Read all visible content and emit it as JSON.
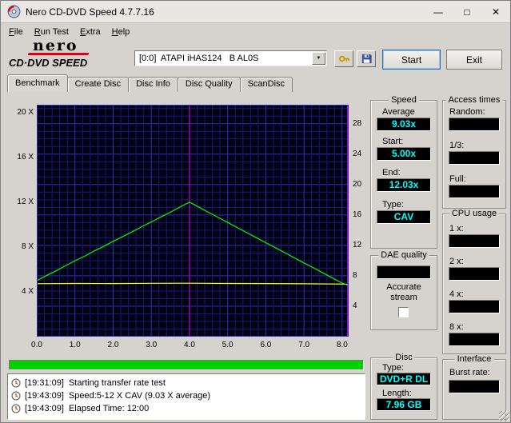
{
  "window": {
    "title": "Nero CD-DVD Speed 4.7.7.16",
    "controls": {
      "minimize": "—",
      "maximize": "□",
      "close": "✕"
    }
  },
  "menu": {
    "items": [
      {
        "label": "File"
      },
      {
        "label": "Run Test"
      },
      {
        "label": "Extra"
      },
      {
        "label": "Help"
      }
    ]
  },
  "toolbar": {
    "logo": {
      "brand": "nero",
      "product": "CD·DVD SPEED"
    },
    "drive_select": {
      "value": "[0:0]  ATAPI iHAS124   B AL0S"
    },
    "start_label": "Start",
    "exit_label": "Exit"
  },
  "tabs": [
    {
      "label": "Benchmark",
      "active": true
    },
    {
      "label": "Create Disc",
      "active": false
    },
    {
      "label": "Disc Info",
      "active": false
    },
    {
      "label": "Disc Quality",
      "active": false
    },
    {
      "label": "ScanDisc",
      "active": false
    }
  ],
  "panels": {
    "speed": {
      "title": "Speed",
      "average_label": "Average",
      "average": "9.03x",
      "start_label": "Start:",
      "start": "5.00x",
      "end_label": "End:",
      "end": "12.03x",
      "type_label": "Type:",
      "type": "CAV"
    },
    "access_times": {
      "title": "Access times",
      "random_label": "Random:",
      "random": "",
      "third_label": "1/3:",
      "third": "",
      "full_label": "Full:",
      "full": ""
    },
    "cpu_usage": {
      "title": "CPU usage",
      "x1_label": "1 x:",
      "x1": "",
      "x2_label": "2 x:",
      "x2": "",
      "x4_label": "4 x:",
      "x4": "",
      "x8_label": "8 x:",
      "x8": ""
    },
    "dae_quality": {
      "title": "DAE quality",
      "value": "",
      "accurate_line1": "Accurate",
      "accurate_line2": "stream",
      "accurate_checked": false
    },
    "disc": {
      "title": "Disc",
      "type_label": "Type:",
      "type": "DVD+R DL",
      "length_label": "Length:",
      "length": "7.96 GB"
    },
    "interface": {
      "title": "Interface",
      "burst_label": "Burst rate:",
      "burst": ""
    }
  },
  "progress": {
    "percent": 100
  },
  "log": {
    "lines": [
      {
        "time": "[19:31:09]",
        "text": "Starting transfer rate test"
      },
      {
        "time": "[19:43:09]",
        "text": "Speed:5-12 X CAV (9.03 X average)"
      },
      {
        "time": "[19:43:09]",
        "text": "Elapsed Time: 12:00"
      }
    ]
  },
  "chart_data": {
    "type": "line",
    "title": "",
    "xlabel": "",
    "ylabel": "",
    "x_range": [
      0,
      8.17
    ],
    "x_ticks": [
      "0.0",
      "1.0",
      "2.0",
      "3.0",
      "4.0",
      "5.0",
      "6.0",
      "7.0",
      "8.0"
    ],
    "left_axis": {
      "ticks": [
        4,
        8,
        12,
        16,
        20
      ],
      "labels": [
        "4 X",
        "8 X",
        "12 X",
        "16 X",
        "20 X"
      ],
      "range": [
        0,
        20.75
      ]
    },
    "right_axis": {
      "ticks": [
        4,
        8,
        12,
        16,
        20,
        24,
        28
      ],
      "range": [
        0,
        30.5
      ]
    },
    "grid": {
      "x_step": 0.2,
      "x_major_every": 5,
      "y_step": 1,
      "y_major_every": 4,
      "minor_color": "#17177e",
      "major_color": "#2d2dc8",
      "bg": "#020211"
    },
    "markers": [
      {
        "type": "vline",
        "x": 4.0,
        "color": "#d400d4"
      },
      {
        "type": "vline",
        "x": 8.14,
        "color": "#d400d4"
      }
    ],
    "series": [
      {
        "name": "rotation-speed",
        "color": "#ffff00",
        "x": [
          0,
          1,
          2,
          3,
          4,
          5,
          6,
          7,
          8,
          8.14
        ],
        "y": [
          4.74,
          4.76,
          4.75,
          4.77,
          4.78,
          4.76,
          4.75,
          4.73,
          4.7,
          4.68
        ]
      },
      {
        "name": "transfer-rate",
        "color": "#00ff00",
        "x": [
          0,
          0.25,
          0.5,
          0.75,
          1,
          1.25,
          1.5,
          1.75,
          2,
          2.25,
          2.5,
          2.75,
          3,
          3.25,
          3.5,
          3.75,
          4,
          4.2,
          4.4,
          4.6,
          4.8,
          5,
          5.25,
          5.5,
          5.75,
          6,
          6.25,
          6.5,
          6.75,
          7,
          7.25,
          7.5,
          7.75,
          8,
          8.14
        ],
        "y": [
          5.0,
          5.46,
          5.88,
          6.34,
          6.79,
          7.19,
          7.66,
          8.07,
          8.53,
          8.95,
          9.39,
          9.84,
          10.26,
          10.71,
          11.13,
          11.6,
          12.03,
          11.68,
          11.3,
          10.95,
          10.58,
          10.22,
          9.77,
          9.31,
          8.86,
          8.41,
          7.96,
          7.51,
          7.05,
          6.6,
          6.15,
          5.7,
          5.24,
          4.79,
          4.62
        ]
      }
    ],
    "legend": "none",
    "summary": {
      "average_speed_x": 9.03,
      "start_speed_x": 5.0,
      "end_speed_x": 12.03,
      "mode": "CAV"
    }
  },
  "colors": {
    "value_text": "#00ffff",
    "value_bg": "#000000",
    "progress": "#00cf00",
    "transfer_line": "#00ff00",
    "rotation_line": "#ffff00",
    "layer_marker": "#d400d4"
  }
}
